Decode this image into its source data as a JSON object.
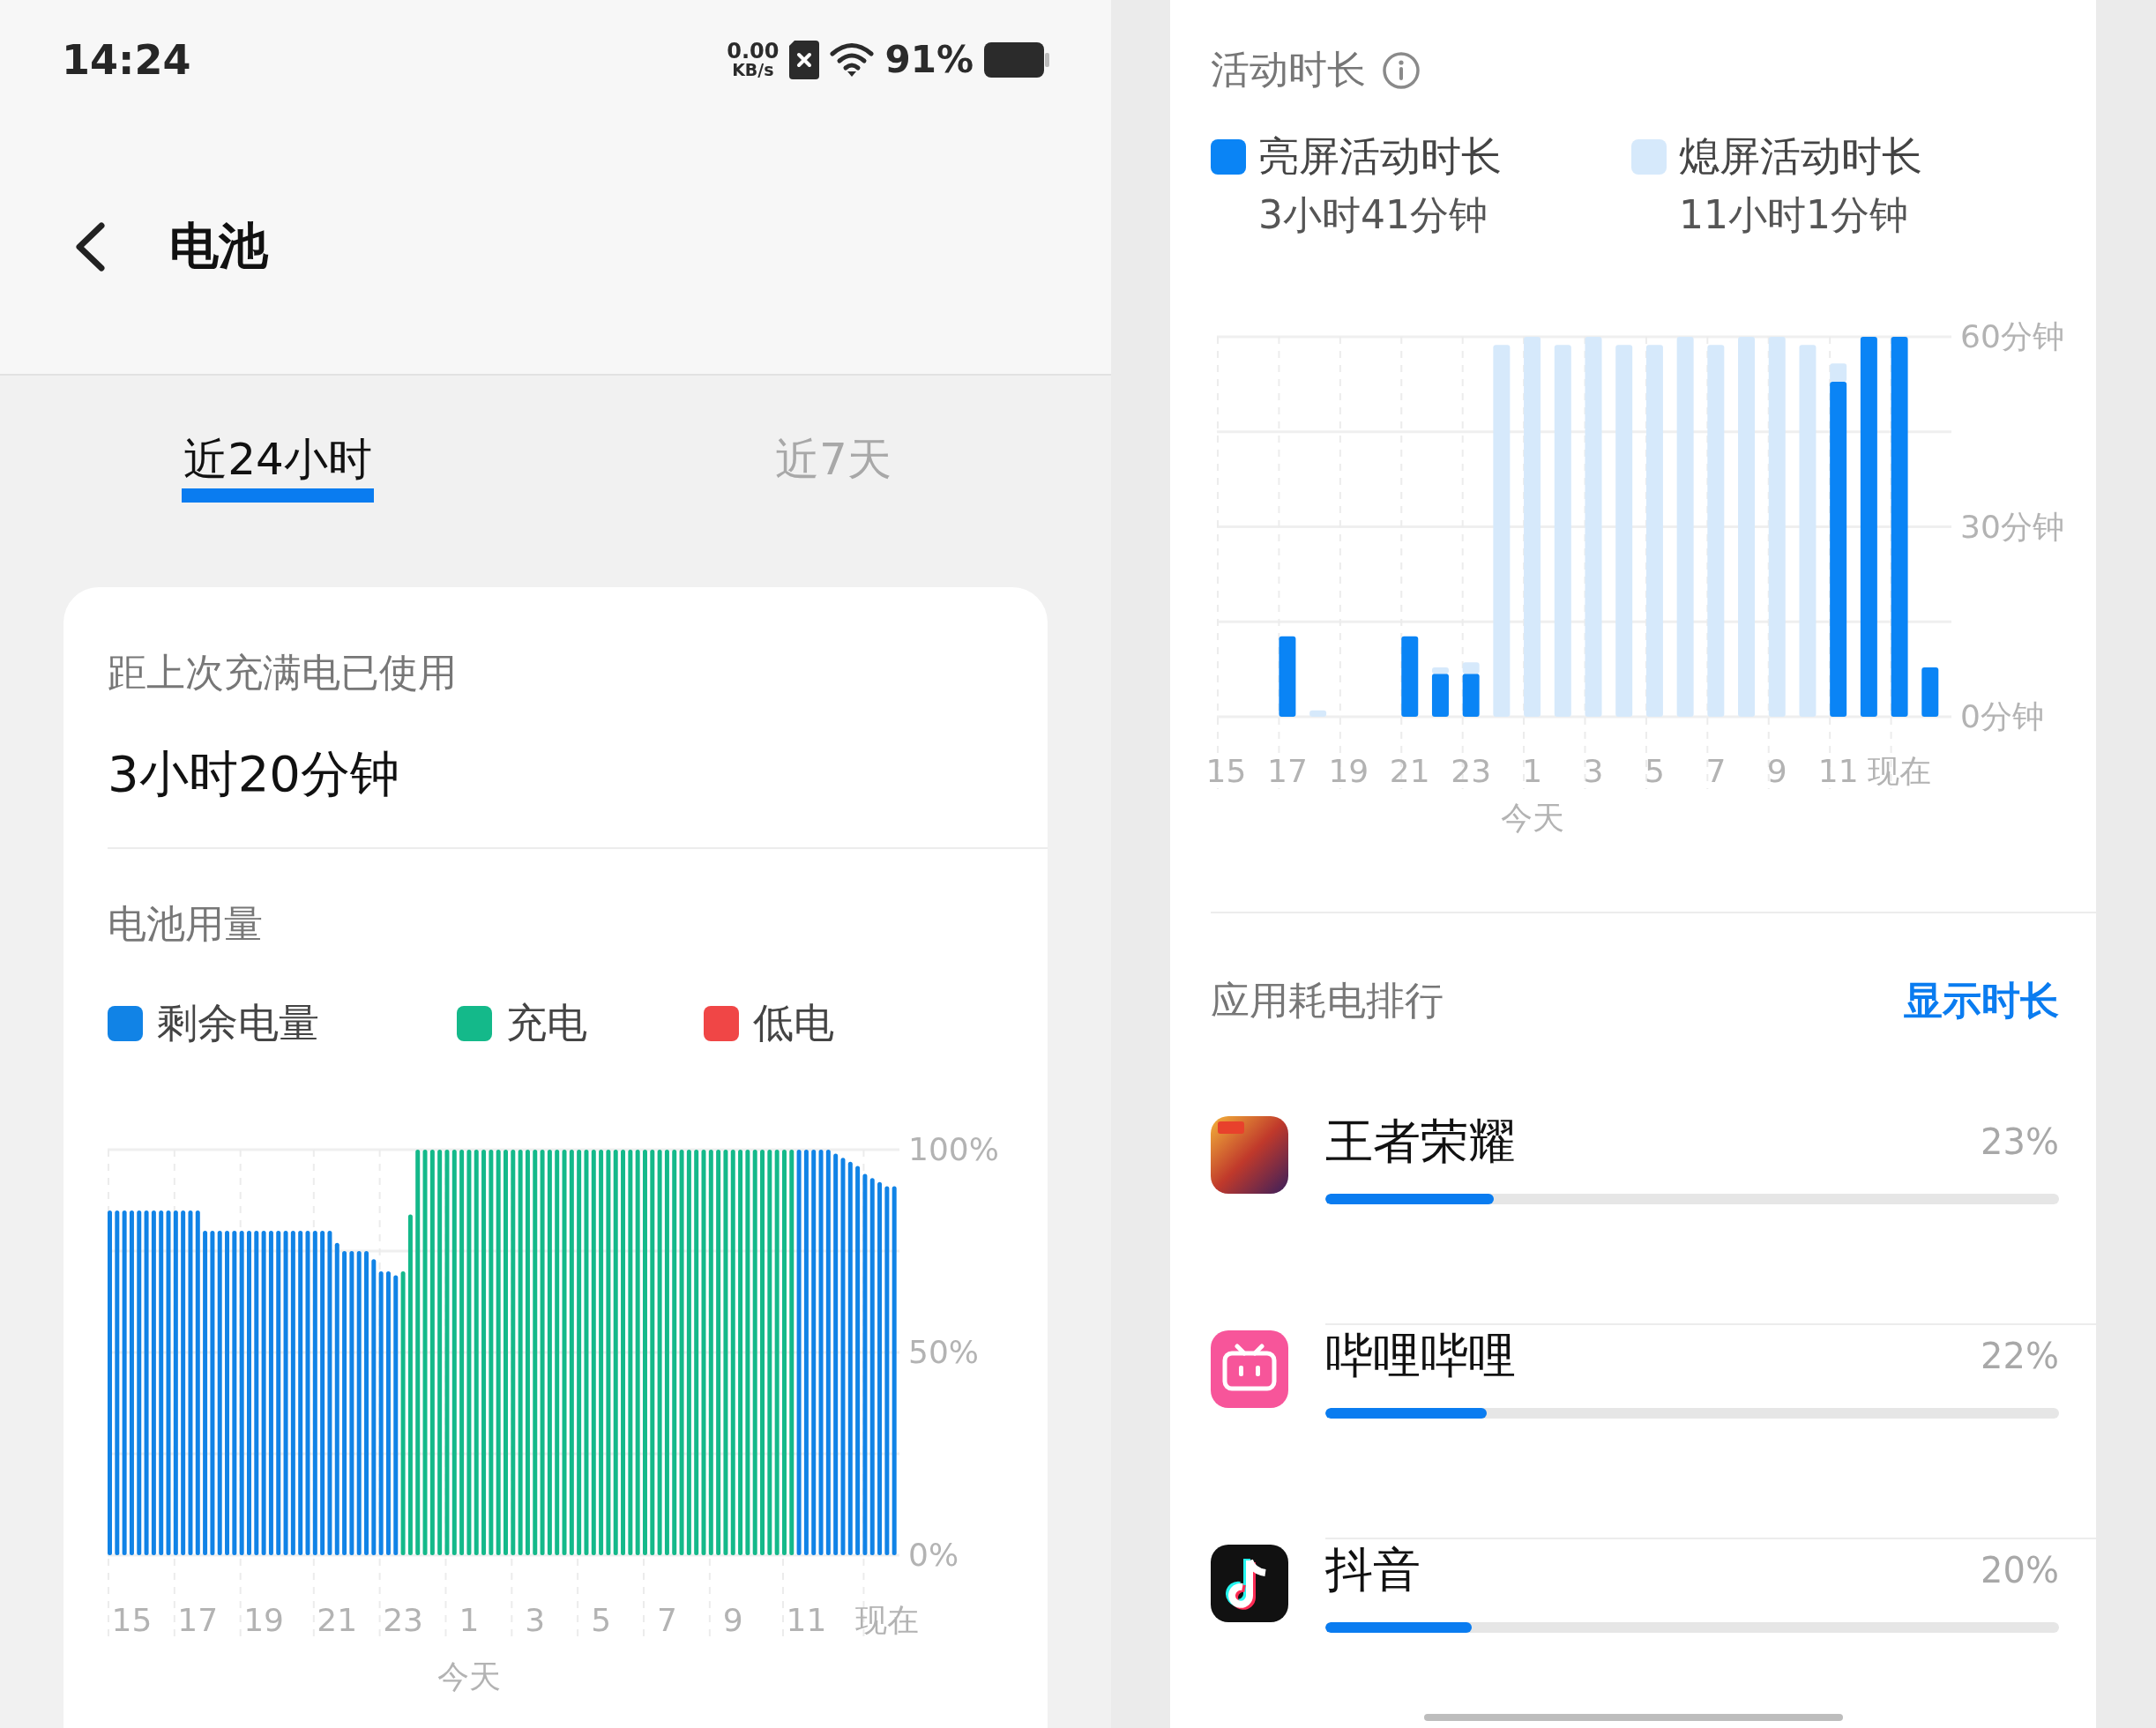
{
  "status_bar": {
    "time": "14:24",
    "net_speed": "0.00",
    "net_unit": "KB/s",
    "battery_text": "91%"
  },
  "header": {
    "title": "电池"
  },
  "tabs": [
    {
      "label": "近24小时",
      "selected": true
    },
    {
      "label": "近7天",
      "selected": false
    }
  ],
  "summary": {
    "label": "距上次充满电已使用",
    "value": "3小时20分钟"
  },
  "battery_usage": {
    "title": "电池用量",
    "chart_data": {
      "type": "bar",
      "grid": true,
      "ylim": [
        0,
        100
      ],
      "yticks": [
        {
          "value": 0,
          "label": "0%"
        },
        {
          "value": 50,
          "label": "50%"
        },
        {
          "value": 100,
          "label": "100%"
        }
      ],
      "categories": [
        null,
        null,
        null,
        "15",
        null,
        null,
        null,
        null,
        null,
        null,
        null,
        null,
        "17",
        null,
        null,
        null,
        null,
        null,
        null,
        null,
        null,
        "19",
        null,
        null,
        null,
        null,
        null,
        null,
        null,
        null,
        null,
        "21",
        null,
        null,
        null,
        null,
        null,
        null,
        null,
        null,
        "23",
        null,
        null,
        null,
        null,
        null,
        null,
        null,
        null,
        "1",
        null,
        null,
        null,
        null,
        null,
        null,
        null,
        null,
        "3",
        null,
        null,
        null,
        null,
        null,
        null,
        null,
        null,
        "5",
        null,
        null,
        null,
        null,
        null,
        null,
        null,
        null,
        "7",
        null,
        null,
        null,
        null,
        null,
        null,
        null,
        null,
        "9",
        null,
        null,
        null,
        null,
        null,
        null,
        null,
        null,
        null,
        "11",
        null,
        null,
        null,
        null,
        null,
        null,
        null,
        null,
        null,
        null,
        "现在",
        null
      ],
      "annotations": [
        "今天"
      ],
      "series": [
        {
          "name": "剩余电量",
          "color": "#1183e6",
          "values": [
            85,
            85,
            85,
            85,
            85,
            85,
            85,
            85,
            85,
            85,
            85,
            85,
            85,
            80,
            80,
            80,
            80,
            80,
            80,
            80,
            80,
            80,
            80,
            80,
            80,
            80,
            80,
            80,
            80,
            80,
            80,
            77,
            75,
            75,
            75,
            75,
            73,
            70,
            70,
            69,
            null,
            null,
            null,
            null,
            null,
            null,
            null,
            null,
            null,
            null,
            null,
            null,
            null,
            null,
            null,
            null,
            null,
            null,
            null,
            null,
            null,
            null,
            null,
            null,
            null,
            null,
            null,
            null,
            null,
            null,
            null,
            null,
            null,
            null,
            null,
            null,
            null,
            null,
            null,
            null,
            null,
            null,
            null,
            null,
            null,
            null,
            null,
            null,
            null,
            null,
            null,
            null,
            null,
            null,
            100,
            100,
            100,
            100,
            100,
            99,
            98,
            97,
            96,
            94,
            93,
            92,
            91,
            91
          ]
        },
        {
          "name": "充电",
          "color": "#14b98a",
          "values": [
            null,
            null,
            null,
            null,
            null,
            null,
            null,
            null,
            null,
            null,
            null,
            null,
            null,
            null,
            null,
            null,
            null,
            null,
            null,
            null,
            null,
            null,
            null,
            null,
            null,
            null,
            null,
            null,
            null,
            null,
            null,
            null,
            null,
            null,
            null,
            null,
            null,
            null,
            null,
            null,
            70,
            84,
            100,
            100,
            100,
            100,
            100,
            100,
            100,
            100,
            100,
            100,
            100,
            100,
            100,
            100,
            100,
            100,
            100,
            100,
            100,
            100,
            100,
            100,
            100,
            100,
            100,
            100,
            100,
            100,
            100,
            100,
            100,
            100,
            100,
            100,
            100,
            100,
            100,
            100,
            100,
            100,
            100,
            100,
            100,
            100,
            100,
            100,
            100,
            100,
            100,
            100,
            100,
            100,
            null,
            null,
            null,
            null,
            null,
            null,
            null,
            null,
            null,
            null,
            null,
            null,
            null,
            null
          ]
        },
        {
          "name": "低电",
          "color": "#f04646",
          "values": [
            null,
            null,
            null,
            null,
            null,
            null,
            null,
            null,
            null,
            null,
            null,
            null,
            null,
            null,
            null,
            null,
            null,
            null,
            null,
            null,
            null,
            null,
            null,
            null,
            null,
            null,
            null,
            null,
            null,
            null,
            null,
            null,
            null,
            null,
            null,
            null,
            null,
            null,
            null,
            null,
            null,
            null,
            null,
            null,
            null,
            null,
            null,
            null,
            null,
            null,
            null,
            null,
            null,
            null,
            null,
            null,
            null,
            null,
            null,
            null,
            null,
            null,
            null,
            null,
            null,
            null,
            null,
            null,
            null,
            null,
            null,
            null,
            null,
            null,
            null,
            null,
            null,
            null,
            null,
            null,
            null,
            null,
            null,
            null,
            null,
            null,
            null,
            null,
            null,
            null,
            null,
            null,
            null,
            null,
            null,
            null,
            null,
            null,
            null,
            null,
            null,
            null,
            null,
            null,
            null,
            null,
            null,
            null
          ]
        }
      ]
    }
  },
  "activity": {
    "title": "活动时长",
    "totals": [
      "3小时41分钟",
      "11小时1分钟"
    ],
    "chart_data": {
      "type": "bar",
      "stacked": true,
      "grid": true,
      "categories": [
        "15",
        null,
        "17",
        null,
        "19",
        null,
        "21",
        null,
        "23",
        null,
        "1",
        null,
        "3",
        null,
        "5",
        null,
        "7",
        null,
        "9",
        null,
        "11",
        null,
        "现在",
        null
      ],
      "ylim": [
        0,
        60
      ],
      "yticks": [
        {
          "value": 0,
          "label": "0分钟"
        },
        {
          "value": 30,
          "label": "30分钟"
        },
        {
          "value": 60,
          "label": "60分钟"
        }
      ],
      "annotations": [
        "今天"
      ],
      "series": [
        {
          "name": "亮屏活动时长",
          "color": "#0a84f5",
          "values": [
            0,
            0,
            12.7,
            0,
            0,
            0,
            12.7,
            6.8,
            6.8,
            0,
            0,
            0,
            0,
            0,
            0,
            0,
            0,
            0,
            0,
            0,
            52.9,
            60,
            60,
            7.8
          ]
        },
        {
          "name": "熄屏活动时长",
          "color": "#d6e9fb",
          "values": [
            0,
            0,
            0,
            1,
            0,
            0,
            0,
            1,
            1.8,
            58.7,
            60,
            58.7,
            60,
            58.7,
            58.7,
            60,
            58.7,
            60,
            60,
            58.7,
            2.9,
            0,
            0,
            0
          ]
        }
      ]
    }
  },
  "app_ranking": {
    "title": "应用耗电排行",
    "action": "显示时长",
    "apps": [
      {
        "kind": "game",
        "name": "王者荣耀",
        "percent": "23%",
        "level": 0.23
      },
      {
        "kind": "video",
        "name": "哔哩哔哩",
        "percent": "22%",
        "level": 0.22
      },
      {
        "kind": "music",
        "name": "抖音",
        "percent": "20%",
        "level": 0.2
      }
    ]
  }
}
